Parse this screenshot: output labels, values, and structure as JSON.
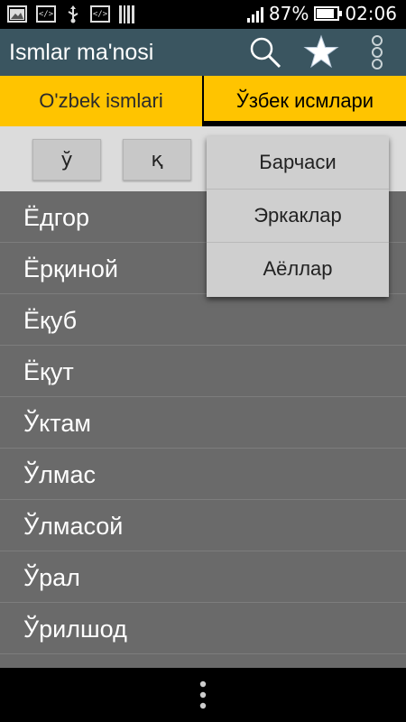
{
  "status_bar": {
    "icons": [
      "gallery-icon",
      "code-icon",
      "usb-icon",
      "code-icon",
      "barcode-icon"
    ],
    "code_glyph": "</>",
    "battery_percent": "87%",
    "battery_level": 0.87,
    "time": "02:06"
  },
  "app_bar": {
    "title": "Ismlar ma'nosi",
    "icons": [
      "search-icon",
      "star-icon",
      "overflow-menu-icon"
    ]
  },
  "tabs": [
    {
      "label": "O'zbek ismlari",
      "active": false
    },
    {
      "label": "Ўзбек исмлари",
      "active": true
    }
  ],
  "letter_filters": [
    "ў",
    "қ"
  ],
  "names": [
    "Ёдгор",
    "Ёрқиной",
    "Ёқуб",
    "Ёқут",
    "Ўктам",
    "Ўлмас",
    "Ўлмасой",
    "Ўрал",
    "Ўрилшод"
  ],
  "gender_menu": {
    "items": [
      "Барчаси",
      "Эркаклар",
      "Аёллар"
    ]
  },
  "nav_bar": {
    "icons": [
      "more-vert-icon"
    ]
  },
  "colors": {
    "app_bar": "#3a5560",
    "tab": "#ffc400",
    "list_bg": "#6a6a6a",
    "menu_bg": "#cfcfcf"
  }
}
